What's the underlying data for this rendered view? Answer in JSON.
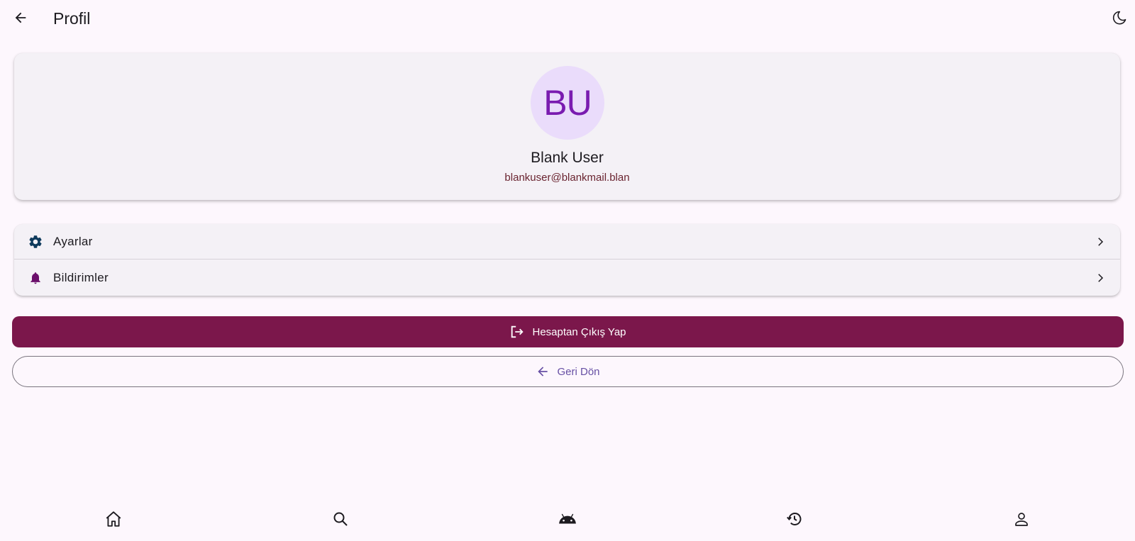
{
  "appbar": {
    "title": "Profil",
    "back_icon": "arrow-left-icon",
    "theme_icon": "moon-icon"
  },
  "profile": {
    "initials": "BU",
    "name": "Blank User",
    "email": "blankuser@blankmail.blan",
    "avatar_bg": "#eadcfb",
    "avatar_fg": "#7a1bb0"
  },
  "menu": {
    "items": [
      {
        "label": "Ayarlar",
        "icon": "gear-icon",
        "icon_color": "#0e3a5c"
      },
      {
        "label": "Bildirimler",
        "icon": "bell-icon",
        "icon_color": "#6b0f6b"
      }
    ]
  },
  "actions": {
    "logout_label": "Hesaptan Çıkış Yap",
    "logout_color": "#7b174b",
    "back_label": "Geri Dön",
    "back_color": "#6750a4"
  },
  "bottom_nav": {
    "items": [
      {
        "icon": "home-icon"
      },
      {
        "icon": "search-icon"
      },
      {
        "icon": "android-icon"
      },
      {
        "icon": "history-icon"
      },
      {
        "icon": "person-icon"
      }
    ]
  }
}
